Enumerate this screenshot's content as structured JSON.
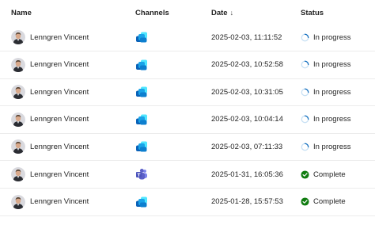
{
  "columns": {
    "name": "Name",
    "channels": "Channels",
    "date": "Date",
    "date_sort": "↓",
    "status": "Status"
  },
  "rows": [
    {
      "name": "Lenngren Vincent",
      "channel": "copilot-icon",
      "date": "2025-02-03, 11:11:52",
      "status": "In progress",
      "status_icon": "spinner-icon"
    },
    {
      "name": "Lenngren Vincent",
      "channel": "copilot-icon",
      "date": "2025-02-03, 10:52:58",
      "status": "In progress",
      "status_icon": "spinner-icon"
    },
    {
      "name": "Lenngren Vincent",
      "channel": "copilot-icon",
      "date": "2025-02-03, 10:31:05",
      "status": "In progress",
      "status_icon": "spinner-icon"
    },
    {
      "name": "Lenngren Vincent",
      "channel": "copilot-icon",
      "date": "2025-02-03, 10:04:14",
      "status": "In progress",
      "status_icon": "spinner-icon"
    },
    {
      "name": "Lenngren Vincent",
      "channel": "copilot-icon",
      "date": "2025-02-03, 07:11:33",
      "status": "In progress",
      "status_icon": "spinner-icon"
    },
    {
      "name": "Lenngren Vincent",
      "channel": "teams-icon",
      "date": "2025-01-31, 16:05:36",
      "status": "Complete",
      "status_icon": "check-circle-icon"
    },
    {
      "name": "Lenngren Vincent",
      "channel": "copilot-icon",
      "date": "2025-01-28, 15:57:53",
      "status": "Complete",
      "status_icon": "check-circle-icon"
    }
  ],
  "colors": {
    "progress": "#0f6cbd",
    "complete": "#107c10",
    "teams": "#5b5fc7",
    "copilot_light": "#50e6ff",
    "copilot_dark": "#0a62b8"
  }
}
